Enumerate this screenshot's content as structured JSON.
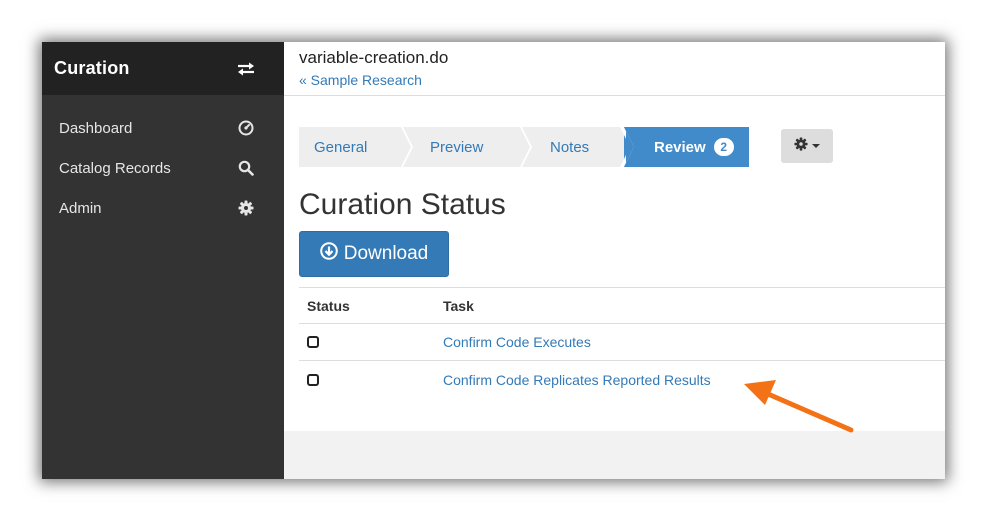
{
  "sidebar": {
    "brand": "Curation",
    "swap_icon": "swap-arrows-icon",
    "items": [
      {
        "label": "Dashboard",
        "icon": "dashboard-icon"
      },
      {
        "label": "Catalog Records",
        "icon": "search-icon"
      },
      {
        "label": "Admin",
        "icon": "gear-icon"
      }
    ]
  },
  "header": {
    "file_title": "variable-creation.do",
    "back_link": "« Sample Research"
  },
  "steps": [
    {
      "label": "General"
    },
    {
      "label": "Preview"
    },
    {
      "label": "Notes"
    },
    {
      "label": "Review",
      "badge": "2",
      "active": true
    }
  ],
  "settings_menu": {
    "icon": "gear-icon"
  },
  "section_title": "Curation Status",
  "download_button": {
    "label": "Download",
    "icon": "download-circle-icon"
  },
  "table": {
    "headers": [
      "Status",
      "Task"
    ],
    "rows": [
      {
        "task": "Confirm Code Executes",
        "checked": false
      },
      {
        "task": "Confirm Code Replicates Reported Results",
        "checked": false
      }
    ]
  },
  "colors": {
    "sidebar_bg": "#333333",
    "sidebar_header_bg": "#222222",
    "accent": "#428bca",
    "link": "#337ab7",
    "annotation_arrow": "#f47216"
  }
}
